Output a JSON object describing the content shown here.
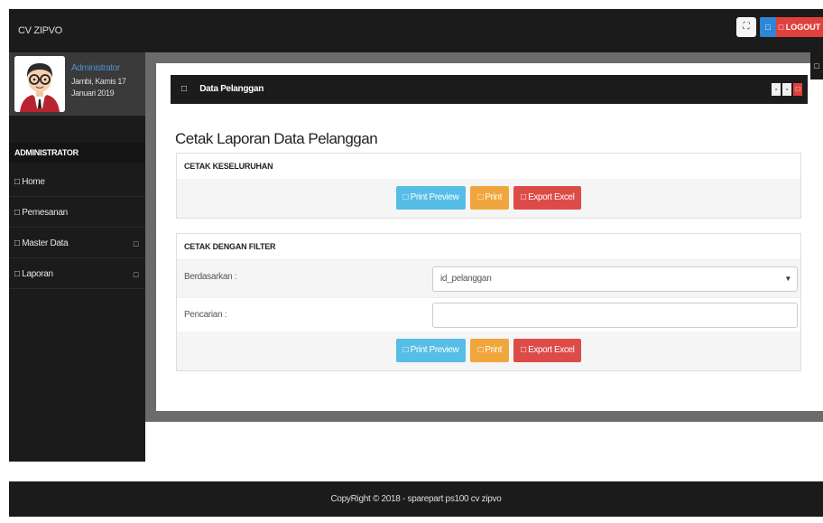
{
  "topbar": {
    "brand": "CV ZIPVO",
    "expand_icon": "⛶",
    "user_icon": "□",
    "logout_label": "□ LOGOUT"
  },
  "sidebar": {
    "user_name": "Administrator",
    "user_date": "Jambi, Kamis 17 Januari 2019",
    "header": "ADMINISTRATOR",
    "items": [
      {
        "label": "□ Home",
        "caret": ""
      },
      {
        "label": "□ Pemesanan",
        "caret": ""
      },
      {
        "label": "□ Master Data",
        "caret": "□"
      },
      {
        "label": "□ Laporan",
        "caret": "□"
      }
    ]
  },
  "panel": {
    "icon": "□",
    "title": "Data Pelanggan",
    "tool_1": "-",
    "tool_2": "-",
    "tool_3": "□"
  },
  "side_tab_icon": "□",
  "page_title": "Cetak Laporan Data Pelanggan",
  "section_all": {
    "title": "CETAK KESELURUHAN",
    "print_preview": "□ Print Preview",
    "print": "□ Print",
    "export_excel": "□ Export Excel"
  },
  "section_filter": {
    "title": "CETAK DENGAN FILTER",
    "based_on_label": "Berdasarkan :",
    "based_on_value": "id_pelanggan",
    "search_label": "Pencarian :",
    "search_value": "",
    "print_preview": "□ Print Preview",
    "print": "□ Print",
    "export_excel": "□ Export Excel"
  },
  "footer": "CopyRight © 2018 - sparepart ps100 cv zipvo",
  "colors": {
    "dark": "#1b1b1b",
    "info": "#55bde6",
    "warning": "#f0a63c",
    "danger": "#dd4b48",
    "primary": "#2f86d4"
  }
}
